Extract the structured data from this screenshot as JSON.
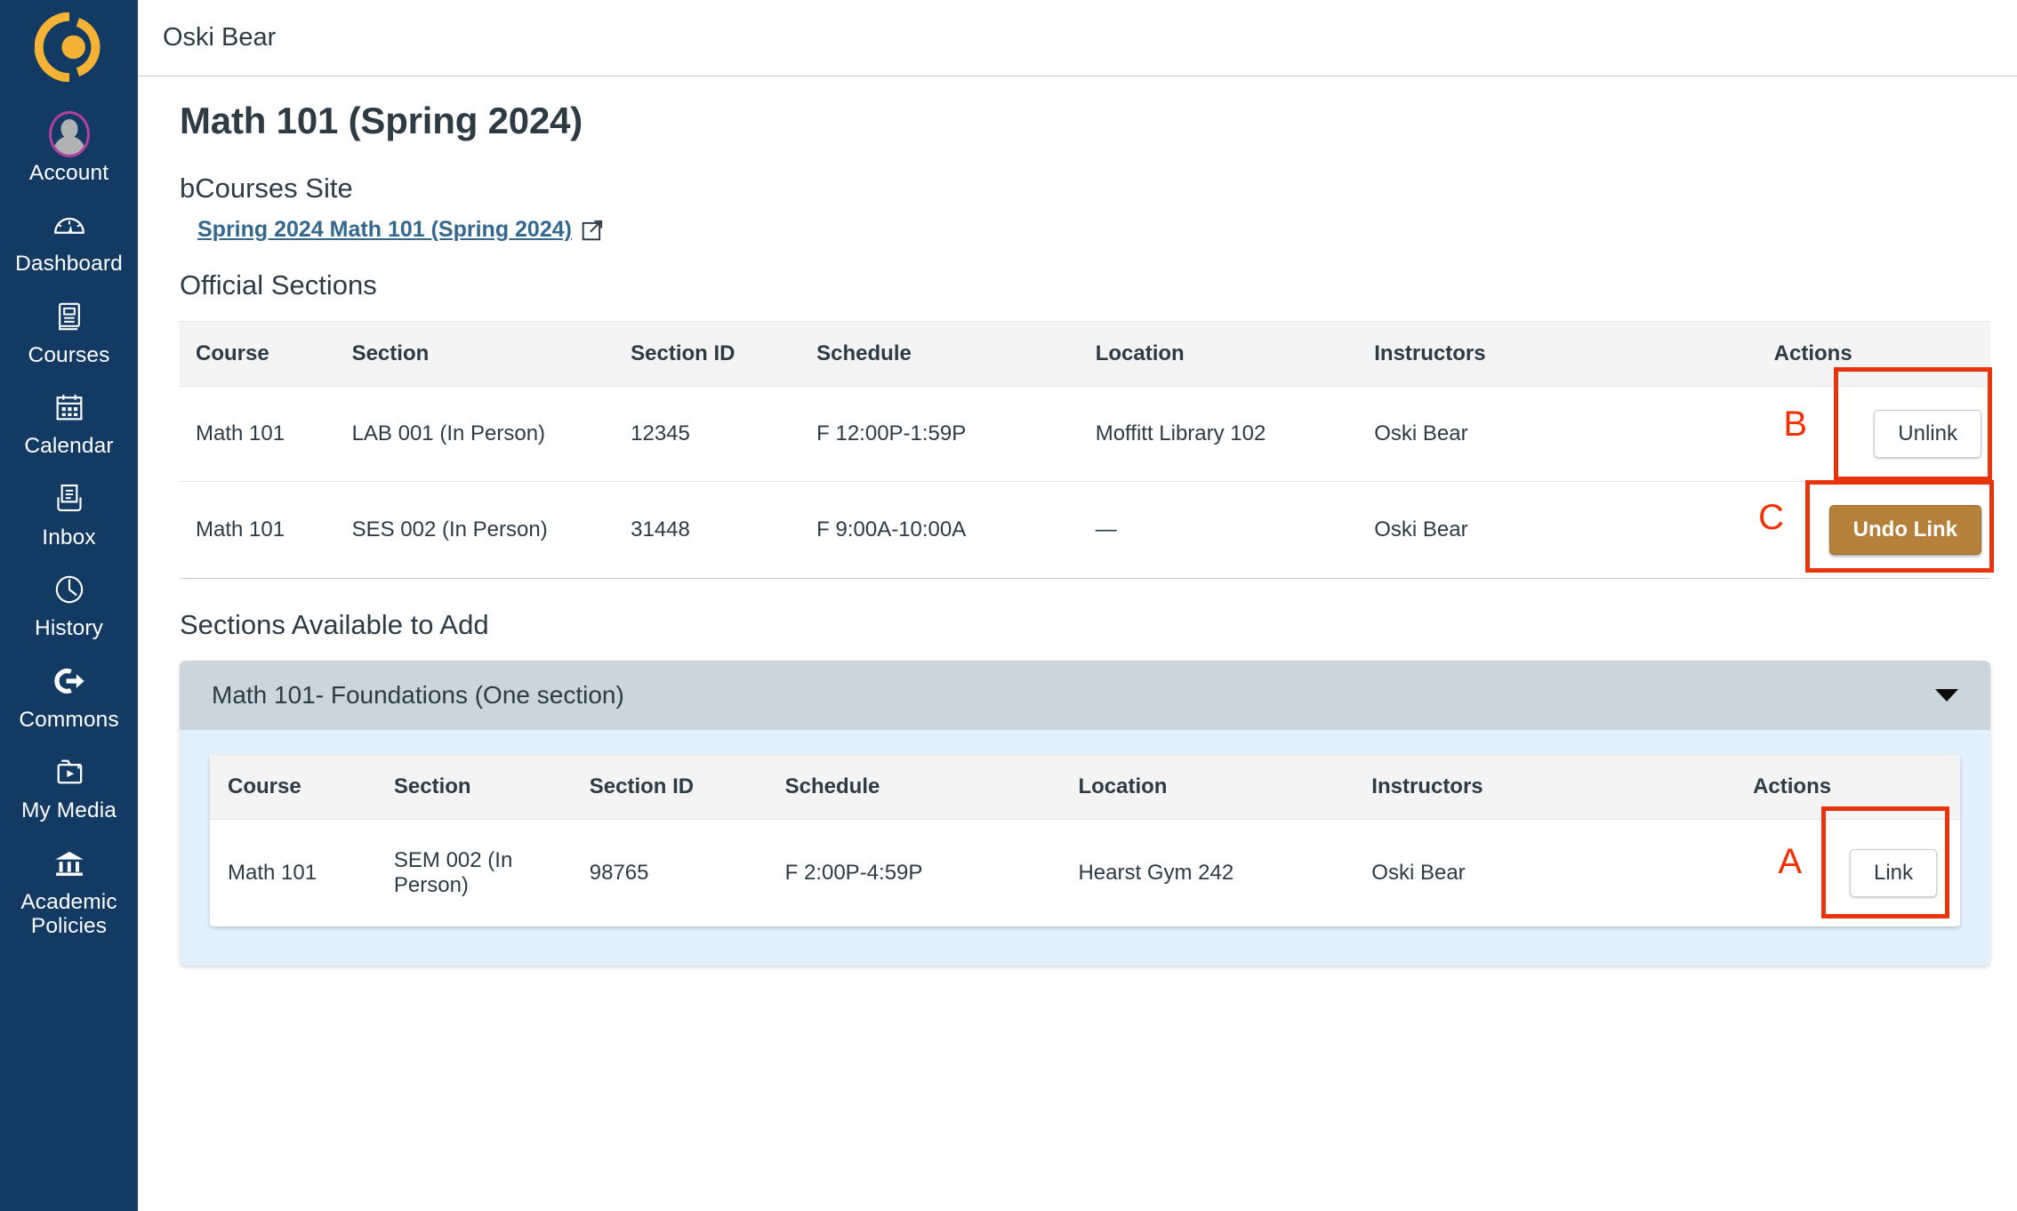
{
  "sidebar": {
    "logo_icon": "canvas-logo-icon",
    "items": [
      {
        "label": "Account",
        "icon": "user-avatar-icon"
      },
      {
        "label": "Dashboard",
        "icon": "gauge-icon"
      },
      {
        "label": "Courses",
        "icon": "book-icon"
      },
      {
        "label": "Calendar",
        "icon": "calendar-icon"
      },
      {
        "label": "Inbox",
        "icon": "inbox-icon"
      },
      {
        "label": "History",
        "icon": "clock-icon"
      },
      {
        "label": "Commons",
        "icon": "arrow-right-circle-icon"
      },
      {
        "label": "My Media",
        "icon": "media-folder-play-icon"
      },
      {
        "label": "Academic Policies",
        "icon": "bank-columns-icon"
      }
    ]
  },
  "topbar": {
    "title": "Oski Bear"
  },
  "page": {
    "title": "Math 101 (Spring 2024)",
    "bcourses_heading": "bCourses Site",
    "bcourses_link": "Spring 2024  Math 101 (Spring 2024)",
    "external_link_icon": "external-link-icon",
    "official_heading": "Official Sections",
    "available_heading": "Sections Available to Add"
  },
  "official_table": {
    "columns": [
      "Course",
      "Section",
      "Section ID",
      "Schedule",
      "Location",
      "Instructors",
      "Actions"
    ],
    "rows": [
      {
        "course": "Math 101",
        "section": "LAB 001 (In Person)",
        "section_id": "12345",
        "schedule": "F 12:00P-1:59P",
        "location": "Moffitt Library 102",
        "instructors": "Oski Bear",
        "action_label": "Unlink",
        "action_style": "secondary",
        "annotation": "B"
      },
      {
        "course": "Math 101",
        "section": "SES 002 (In Person)",
        "section_id": "31448",
        "schedule": "F 9:00A-10:00A",
        "location": "—",
        "instructors": "Oski Bear",
        "action_label": "Undo Link",
        "action_style": "gold",
        "annotation": "C"
      }
    ]
  },
  "accordion": {
    "title": "Math 101- Foundations (One section)",
    "chevron_icon": "chevron-down-icon",
    "table": {
      "columns": [
        "Course",
        "Section",
        "Section ID",
        "Schedule",
        "Location",
        "Instructors",
        "Actions"
      ],
      "rows": [
        {
          "course": "Math 101",
          "section": "SEM 002 (In Person)",
          "section_id": "98765",
          "schedule": "F 2:00P-4:59P",
          "location": "Hearst Gym 242",
          "instructors": "Oski Bear",
          "action_label": "Link",
          "action_style": "secondary",
          "annotation": "A"
        }
      ]
    }
  },
  "colors": {
    "sidebar_bg": "#123a63",
    "logo_gold": "#f5b335",
    "avatar_ring": "#b4409b",
    "link_blue": "#35688e",
    "gold_button": "#b5813a",
    "annotation_red": "#e8340c",
    "accordion_header": "#cbd5dd",
    "accordion_body": "#e1f0fb"
  }
}
